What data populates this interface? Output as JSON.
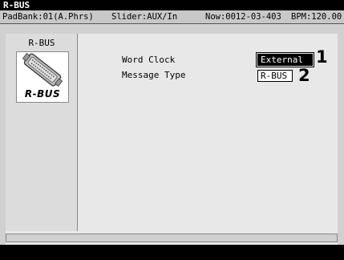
{
  "window": {
    "title": "R-BUS"
  },
  "status": {
    "pad_bank": "PadBank:01(A.Phrs)",
    "slider": "Slider:AUX/In",
    "now": "Now:0012-03-403",
    "bpm": "BPM:120.00"
  },
  "sidebar": {
    "title": "R-BUS",
    "icon": "rbus-connector-icon",
    "caption": "R-BUS"
  },
  "params": [
    {
      "label": "Word Clock",
      "value": "External",
      "callout": "1",
      "selected": true
    },
    {
      "label": "Message Type",
      "value": "R-BUS",
      "callout": "2",
      "selected": false
    }
  ]
}
